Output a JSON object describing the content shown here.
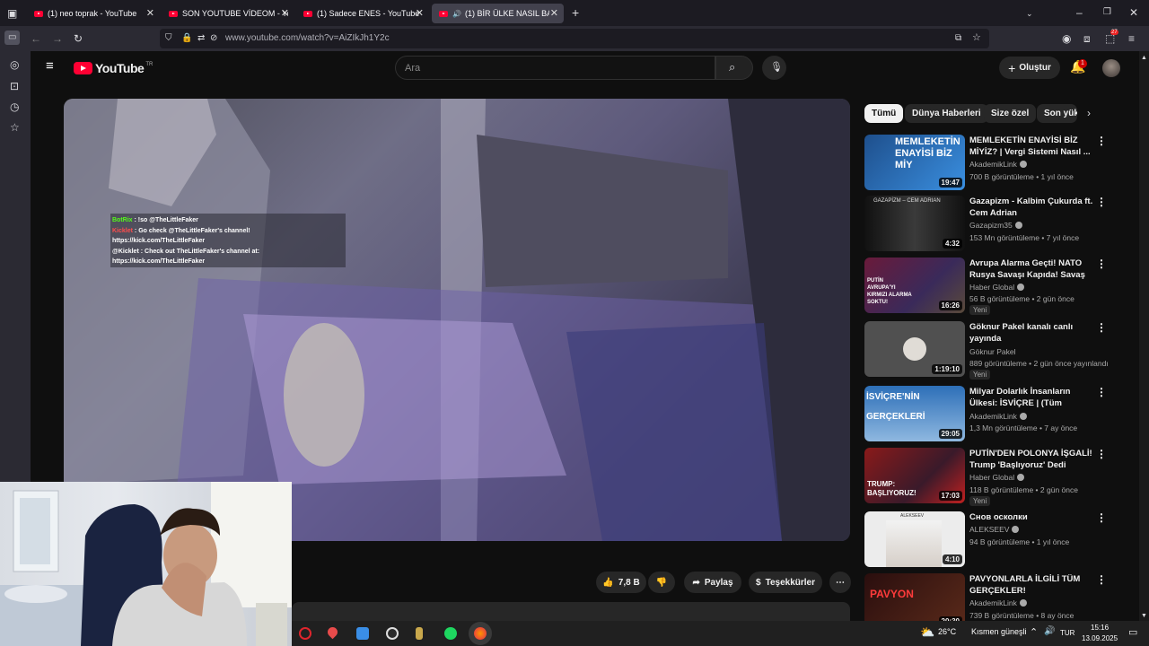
{
  "browser": {
    "tabs": [
      {
        "title": "(1) neo toprak - YouTube",
        "active": false
      },
      {
        "title": "SON YOUTUBE VİDEOM - YouTu",
        "active": false
      },
      {
        "title": "(1) Sadece ENES - YouTube",
        "active": false
      },
      {
        "title": "(1) BİR ÜLKE NASIL BATAR?",
        "active": true
      }
    ],
    "url": "www.youtube.com/watch?v=AiZIkJh1Y2c",
    "badge": "27"
  },
  "youtube": {
    "logo_text": "YouTube",
    "logo_region": "TR",
    "search_placeholder": "Ara",
    "create_label": "Oluştur",
    "notification_count": "1"
  },
  "video": {
    "chat": [
      {
        "user": "BotRix",
        "msg": ": !so @TheLittleFaker"
      },
      {
        "user": "Kicklet",
        "msg": ": Go check @TheLittleFaker's channel!",
        "link": "https://kick.com/TheLittleFaker"
      },
      {
        "user": "@Kicklet",
        "msg": ": Check out TheLittleFaker's channel at:",
        "link": "https://kick.com/TheLittleFaker"
      }
    ]
  },
  "actions": {
    "like_count": "7,8 B",
    "share": "Paylaş",
    "thanks": "Teşekkürler"
  },
  "chips": [
    "Tümü",
    "Dünya Haberleri",
    "Size özel",
    "Son yük"
  ],
  "recommendations": [
    {
      "title": "MEMLEKETİN ENAYİSİ BİZ MİYİZ? | Vergi Sistemi Nasıl ...",
      "channel": "AkademikLink",
      "verified": true,
      "meta": "700 B görüntüleme • 1 yıl önce",
      "duration": "19:47",
      "is_new": false,
      "thumb_text": "MEMLEKETİN ENAYİSİ BİZ MİY",
      "thumb_color": "#2a6fb8"
    },
    {
      "title": "Gazapizm - Kalbim Çukurda ft. Cem Adrian",
      "channel": "Gazapizm35",
      "verified": true,
      "meta": "153 Mn görüntüleme • 7 yıl önce",
      "duration": "4:32",
      "is_new": false,
      "thumb_text": "GAZAPİZM – CEM ADRIAN",
      "thumb_color": "#2a2a2a"
    },
    {
      "title": "Avrupa Alarma Geçti! NATO Rusya Savaşı Kapıda! Savaş ...",
      "channel": "Haber Global",
      "verified": true,
      "meta": "56 B görüntüleme • 2 gün önce",
      "duration": "16:26",
      "is_new": true,
      "new_label": "Yeni",
      "thumb_text": "PUTİN AVRUPA'YI KIRMIZI ALARMA SOKTU!",
      "thumb_color": "#7a1a2e"
    },
    {
      "title": "Göknur Pakel kanalı canlı yayında",
      "channel": "Göknur Pakel",
      "verified": false,
      "meta": "889 görüntüleme • 2 gün önce yayınlandı",
      "duration": "1:19:10",
      "is_new": true,
      "new_label": "Yeni",
      "thumb_text": "",
      "thumb_color": "#5a5a5a"
    },
    {
      "title": "Milyar Dolarlık İnsanların Ülkesi: İSVİÇRE | (Tüm Gerçekleriyle!)",
      "channel": "AkademikLink",
      "verified": true,
      "meta": "1,3 Mn görüntüleme • 7 ay önce",
      "duration": "29:05",
      "is_new": false,
      "thumb_text": "İSVİÇRE'NİN GERÇEKLERİ",
      "thumb_color": "#1f5d9e"
    },
    {
      "title": "PUTİN'DEN POLONYA İŞGALİ! Trump 'Başlıyoruz' Dedi Rusya ...",
      "channel": "Haber Global",
      "verified": true,
      "meta": "118 B görüntüleme • 2 gün önce",
      "duration": "17:03",
      "is_new": true,
      "new_label": "Yeni",
      "thumb_text": "TRUMP: BAŞLIYORUZ!",
      "thumb_color": "#8a1c1c"
    },
    {
      "title": "Снов осколки",
      "channel": "ALEKSEEV",
      "verified": true,
      "meta": "94 B görüntüleme • 1 yıl önce",
      "duration": "4:10",
      "is_new": false,
      "thumb_text": "ALEKSEEV",
      "thumb_color": "#e8e8e8"
    },
    {
      "title": "PAVYONLARLA İLGİLİ TÜM GERÇEKLER!",
      "channel": "AkademikLink",
      "verified": true,
      "meta": "739 B görüntüleme • 8 ay önce",
      "duration": "20:30",
      "is_new": false,
      "thumb_text": "PAVYON",
      "thumb_color": "#3a1414"
    }
  ],
  "taskbar": {
    "weather": "26°C",
    "weather_desc": "Kısmen güneşli",
    "lang": "TUR",
    "time": "15:16",
    "date": "13.09.2025"
  }
}
